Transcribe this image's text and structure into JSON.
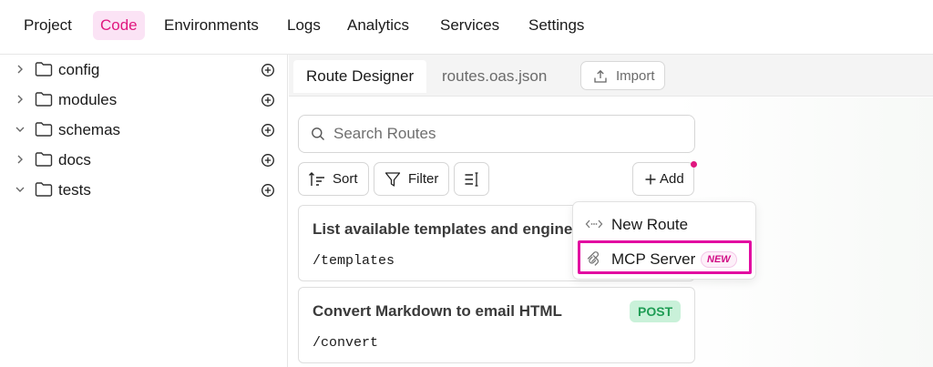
{
  "nav": {
    "items": [
      {
        "label": "Project",
        "active": false
      },
      {
        "label": "Code",
        "active": true
      },
      {
        "label": "Environments",
        "active": false
      },
      {
        "label": "Logs",
        "active": false
      },
      {
        "label": "Analytics",
        "active": false
      },
      {
        "label": "Services",
        "active": false
      },
      {
        "label": "Settings",
        "active": false
      }
    ]
  },
  "sidebar": {
    "items": [
      {
        "label": "config",
        "expanded": false
      },
      {
        "label": "modules",
        "expanded": false
      },
      {
        "label": "schemas",
        "expanded": true
      },
      {
        "label": "docs",
        "expanded": false
      },
      {
        "label": "tests",
        "expanded": true
      }
    ]
  },
  "tabs": [
    {
      "label": "Route Designer",
      "active": true
    },
    {
      "label": "routes.oas.json",
      "active": false
    }
  ],
  "import_label": "Import",
  "search": {
    "placeholder": "Search Routes",
    "value": ""
  },
  "toolbar": {
    "sort_label": "Sort",
    "filter_label": "Filter",
    "add_label": "Add"
  },
  "routes": [
    {
      "title": "List available templates and engines",
      "path": "/templates",
      "method": ""
    },
    {
      "title": "Convert Markdown to email HTML",
      "path": "/convert",
      "method": "POST"
    }
  ],
  "add_menu": {
    "items": [
      {
        "label": "New Route",
        "icon": "code-brackets-icon"
      },
      {
        "label": "MCP Server",
        "icon": "mcp-icon",
        "badge": "NEW",
        "highlighted": true
      }
    ]
  },
  "colors": {
    "accent": "#e0177f",
    "highlight_border": "#e20aa1",
    "post_bg": "#c9f1d9",
    "post_text": "#1f9d55"
  }
}
